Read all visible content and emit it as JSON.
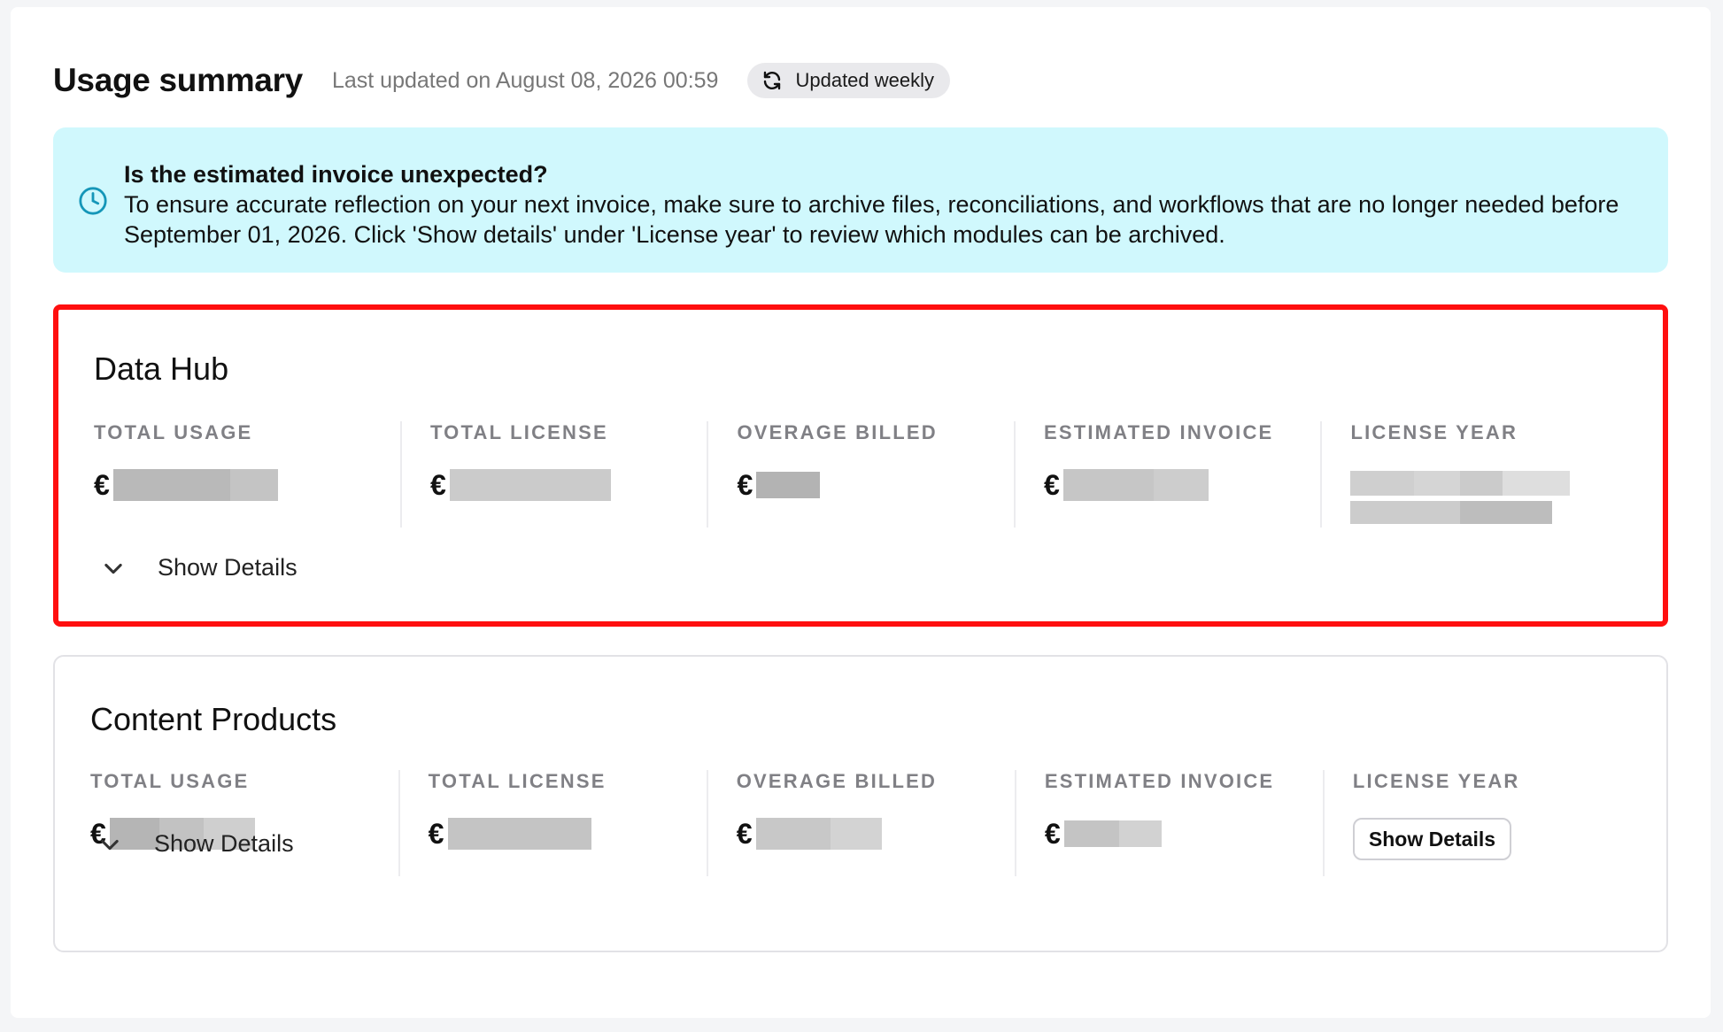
{
  "header": {
    "title": "Usage summary",
    "last_updated": "Last updated on August 08, 2026 00:59",
    "frequency_label": "Updated weekly"
  },
  "banner": {
    "title": "Is the estimated invoice unexpected?",
    "message": "To ensure accurate reflection on your next invoice, make sure to archive files, reconciliations, and workflows that are no longer needed before September 01, 2026. Click 'Show details' under 'License year' to review which modules can be archived."
  },
  "labels": {
    "total_usage": "TOTAL USAGE",
    "total_license": "TOTAL LICENSE",
    "overage_billed": "OVERAGE BILLED",
    "estimated_invoice": "ESTIMATED INVOICE",
    "license_year": "LICENSE YEAR",
    "currency": "€"
  },
  "data_hub": {
    "title": "Data Hub",
    "show_details": "Show Details"
  },
  "content_products": {
    "title": "Content Products",
    "show_details": "Show Details",
    "license_year_button": "Show Details"
  },
  "colors": {
    "highlight_border": "#ff0f0f",
    "banner_bg": "#d0f8fd",
    "info_icon": "#1596b8"
  }
}
